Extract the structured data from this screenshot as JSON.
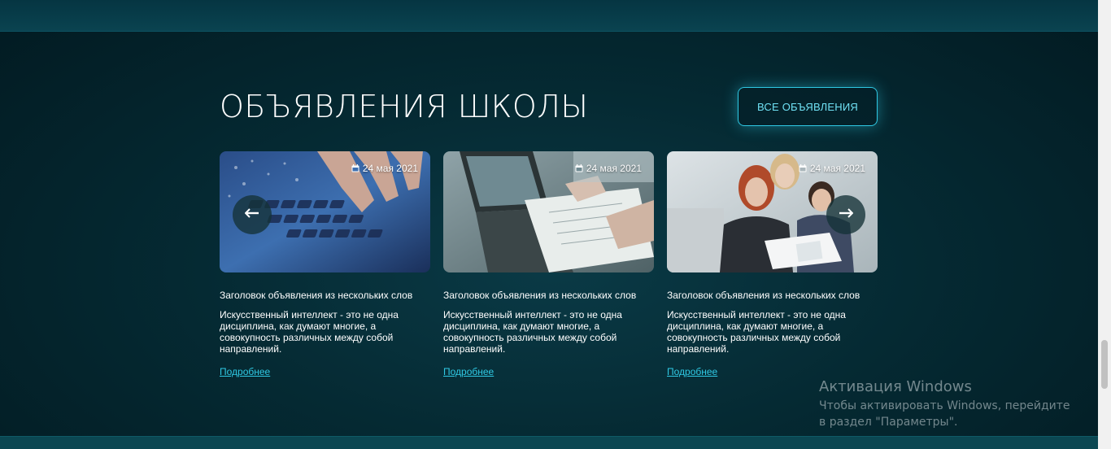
{
  "section": {
    "title": "ОБЪЯВЛЕНИЯ ШКОЛЫ",
    "all_button_label": "ВСЕ ОБЪЯВЛЕНИЯ"
  },
  "cards": [
    {
      "date": "24 мая 2021",
      "title": "Заголовок объявления из нескольких слов",
      "text": "Искусственный интеллект - это не одна дисциплина, как думают многие, а совокупность различных между собой направлений.",
      "link": "Подробнее",
      "image": "keyboard-photo"
    },
    {
      "date": "24 мая 2021",
      "title": "Заголовок объявления из нескольких слов",
      "text": "Искусственный интеллект - это не одна дисциплина, как думают многие, а совокупность различных между собой направлений.",
      "link": "Подробнее",
      "image": "laptop-documents-photo"
    },
    {
      "date": "24 мая 2021",
      "title": "Заголовок объявления из нескольких слов",
      "text": "Искусственный интеллект - это не одна дисциплина, как думают многие, а совокупность различных между собой направлений.",
      "link": "Подробнее",
      "image": "team-meeting-photo"
    }
  ],
  "carousel": {
    "prev_icon": "arrow-left-icon",
    "next_icon": "arrow-right-icon"
  },
  "windows_activation": {
    "title": "Активация Windows",
    "text": "Чтобы активировать Windows, перейдите в раздел \"Параметры\"."
  },
  "colors": {
    "accent": "#2fc9e4",
    "background": "#052a33"
  }
}
